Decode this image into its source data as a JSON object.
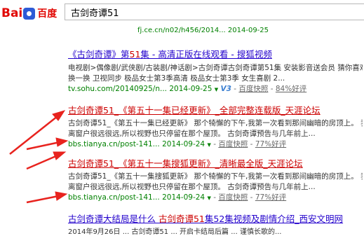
{
  "logo": {
    "bai": "Bai",
    "du": "du",
    "baidu_cn": "百度"
  },
  "search": {
    "query": "古剑奇谭51"
  },
  "clipped_top": {
    "text": "fj.ce.cn/n02/h456/2014...  2014-09-25"
  },
  "results": [
    {
      "title_pre": "《古剑奇谭》第",
      "title_hl": "51",
      "title_post": "集 - 高清正版在线观看 - 搜狐视频",
      "line1": "电视剧>偶像剧/武侠剧/古装剧/神话剧>古剑奇谭古剑奇谭第51集 安装影音送会员 猜你喜欢",
      "line2": "换一换 卫视同步 极品女士第3季高清 极品女士第3季 女生喜剧 2...",
      "url": "tv.sohu.com/20140925/n...",
      "date": "2014-09-25",
      "v3": "V3",
      "snap": "百度快照",
      "rate": "84%好评"
    },
    {
      "title": "古剑奇谭51_《第五十一集已经更新》_全部完整连载版_天涯论坛",
      "line1": "古剑奇谭51_《第五十一集已经更新》 那个犄懈的下午,我第一次看到那间幽暗的房顶上。 我总是",
      "line2": "离窗户很远很远,所以视野也只停留在那个屋顶。 古剑奇谭预告与几年前上...",
      "url": "bbs.tianya.cn/post-141...",
      "date": "2014-09-24",
      "snap": "百度快照",
      "rate": "77%好评"
    },
    {
      "title": "古剑奇谭51_《第五十一集搜狐更新》_清晰最全版_天涯论坛",
      "line1": "古剑奇谭51_《第五十一集搜狐更新》 那个犄懈的下午,我第一次看到那间幽暗的房顶上。 我总是",
      "line2": "离窗户很远很远,所以视野也只停留在那个屋顶。 古剑奇谭预告与几年前上...",
      "url": "bbs.tianya.cn/post-141...",
      "date": "2014-09-24",
      "snap": "百度快照",
      "rate": "77%好评"
    },
    {
      "title_pre": "古剑奇谭大结局是什么 ",
      "title_hl": "古剑奇谭51",
      "title_post": "集52集视频及剧情介绍_西安文明网"
    }
  ],
  "bottom_clip": "2014年9月26日 ... 古剑奇谭51 ... 开启卡结局后篇 ... 谨慎长歌的..."
}
